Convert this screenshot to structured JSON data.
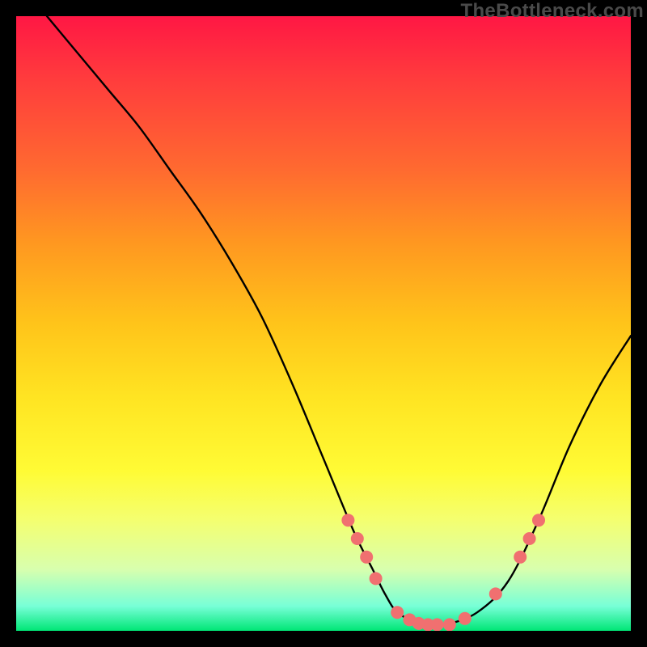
{
  "watermark": "TheBottleneck.com",
  "colors": {
    "background": "#000000",
    "curve": "#000000",
    "dot_fill": "#f07070",
    "dot_stroke": "#b24a4a"
  },
  "chart_data": {
    "type": "line",
    "title": "",
    "xlabel": "",
    "ylabel": "",
    "xlim": [
      0,
      100
    ],
    "ylim": [
      0,
      100
    ],
    "curve": {
      "x": [
        5,
        10,
        15,
        20,
        25,
        30,
        35,
        40,
        45,
        50,
        55,
        58,
        60,
        62,
        65,
        68,
        70,
        75,
        80,
        85,
        90,
        95,
        100
      ],
      "y": [
        100,
        94,
        88,
        82,
        75,
        68,
        60,
        51,
        40,
        28,
        16,
        10,
        6,
        3,
        1.5,
        1,
        1,
        3,
        8,
        18,
        30,
        40,
        48
      ]
    },
    "dots": [
      {
        "x": 54,
        "y": 18
      },
      {
        "x": 55.5,
        "y": 15
      },
      {
        "x": 57,
        "y": 12
      },
      {
        "x": 58.5,
        "y": 8.5
      },
      {
        "x": 62,
        "y": 3
      },
      {
        "x": 64,
        "y": 1.8
      },
      {
        "x": 65.5,
        "y": 1.2
      },
      {
        "x": 67,
        "y": 1
      },
      {
        "x": 68.5,
        "y": 1
      },
      {
        "x": 70.5,
        "y": 1
      },
      {
        "x": 73,
        "y": 2
      },
      {
        "x": 78,
        "y": 6
      },
      {
        "x": 82,
        "y": 12
      },
      {
        "x": 83.5,
        "y": 15
      },
      {
        "x": 85,
        "y": 18
      }
    ]
  }
}
